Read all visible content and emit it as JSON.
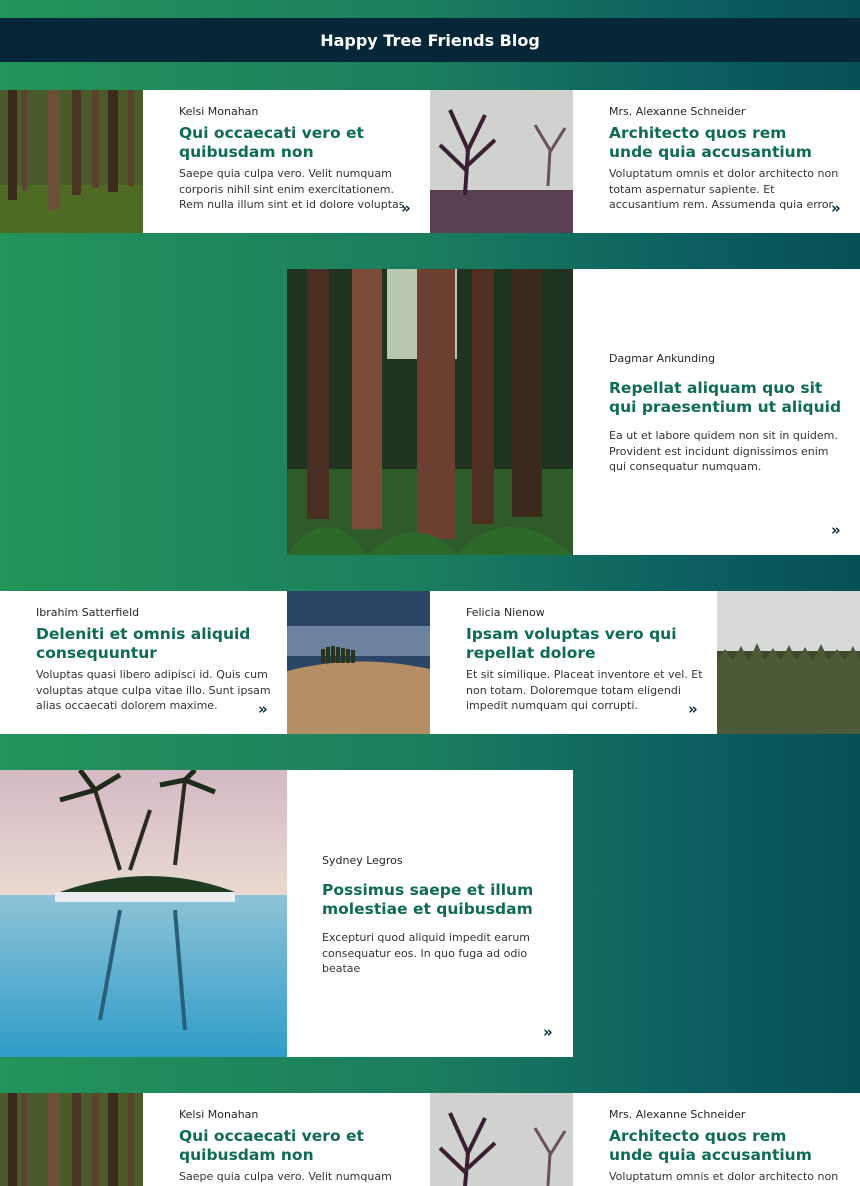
{
  "header": {
    "title": "Happy Tree Friends Blog"
  },
  "posts": [
    {
      "author": "Kelsi Monahan",
      "title_line1": "Qui occaecati vero et",
      "title_line2": "quibusdam non",
      "excerpt": [
        "Saepe quia culpa vero. Velit numquam",
        "corporis nihil sint enim exercitationem.",
        "Rem nulla illum sint et id dolore voluptas"
      ],
      "arrow": "»"
    },
    {
      "author": "Mrs. Alexanne Schneider",
      "title_line1": "Architecto quos rem",
      "title_line2": "unde quia accusantium",
      "excerpt": [
        "Voluptatum omnis et dolor architecto non",
        "totam aspernatur sapiente. Et",
        "accusantium rem. Assumenda quia error"
      ],
      "arrow": "»"
    },
    {
      "author": "Dagmar Ankunding",
      "title_line1": "Repellat aliquam quo sit",
      "title_line2": "qui praesentium ut aliquid",
      "excerpt": [
        "Ea ut et labore quidem non sit in quidem.",
        "Provident est incidunt dignissimos enim",
        "qui consequatur numquam."
      ],
      "arrow": "»"
    },
    {
      "author": "Ibrahim Satterfield",
      "title_line1": "Deleniti et omnis aliquid",
      "title_line2": "consequuntur",
      "excerpt": [
        "Voluptas quasi libero adipisci id. Quis cum",
        "voluptas atque culpa vitae illo. Sunt ipsam",
        "alias occaecati dolorem maxime."
      ],
      "arrow": "»"
    },
    {
      "author": "Felicia Nienow",
      "title_line1": "Ipsam voluptas vero qui",
      "title_line2": "repellat dolore",
      "excerpt": [
        "Et sit similique. Placeat inventore et vel. Et",
        "non totam. Doloremque totam eligendi",
        "impedit numquam qui corrupti."
      ],
      "arrow": "»"
    },
    {
      "author": "Sydney Legros",
      "title_line1": "Possimus saepe et illum",
      "title_line2": "molestiae et quibusdam",
      "excerpt": [
        "Excepturi quod aliquid impedit earum",
        "consequatur eos. In quo fuga ad odio",
        "beatae"
      ],
      "arrow": "»"
    },
    {
      "author": "Kelsi Monahan",
      "title_line1": "Qui occaecati vero et",
      "title_line2": "quibusdam non",
      "excerpt": [
        "Saepe quia culpa vero. Velit numquam"
      ],
      "arrow": ""
    },
    {
      "author": "Mrs. Alexanne Schneider",
      "title_line1": "Architecto quos rem",
      "title_line2": "unde quia accusantium",
      "excerpt": [
        "Voluptatum omnis et dolor architecto non"
      ],
      "arrow": ""
    }
  ],
  "images": [
    "forest-trunks-image",
    "misty-tree-image",
    "redwood-forest-image",
    "cypress-hill-image",
    "pine-forest-image",
    "palm-pool-image"
  ],
  "colors": {
    "header_bg": "#052738",
    "title_green": "#0e6b55",
    "accent_green": "#23945a",
    "teal_dark": "#055057"
  }
}
